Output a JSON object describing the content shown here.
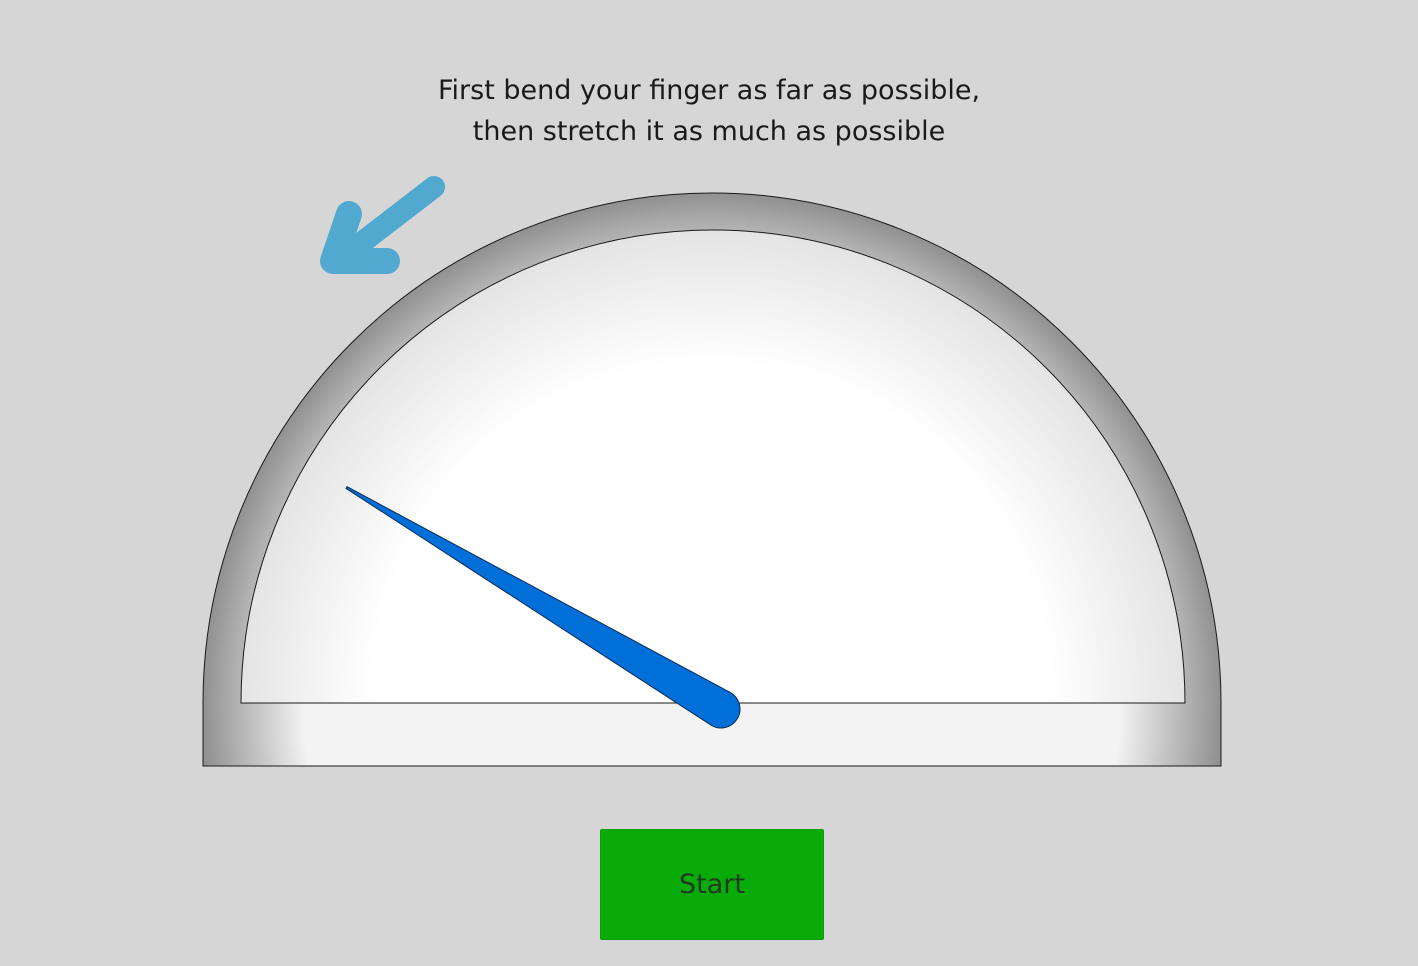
{
  "instructions": {
    "line1": "First bend your finger as far as possible,",
    "line2": "then stretch it as much as possible"
  },
  "gauge": {
    "needle_level_percent": 17,
    "needle_color": "#0070d8",
    "arrow_color": "#52a9d0",
    "dial_color": "#ffffff",
    "bezel_color": "#9a9a9a"
  },
  "icons": {
    "direction_hint": "arrow-down-left-icon"
  },
  "start_button": {
    "label": "Start",
    "color": "#09ab09"
  }
}
